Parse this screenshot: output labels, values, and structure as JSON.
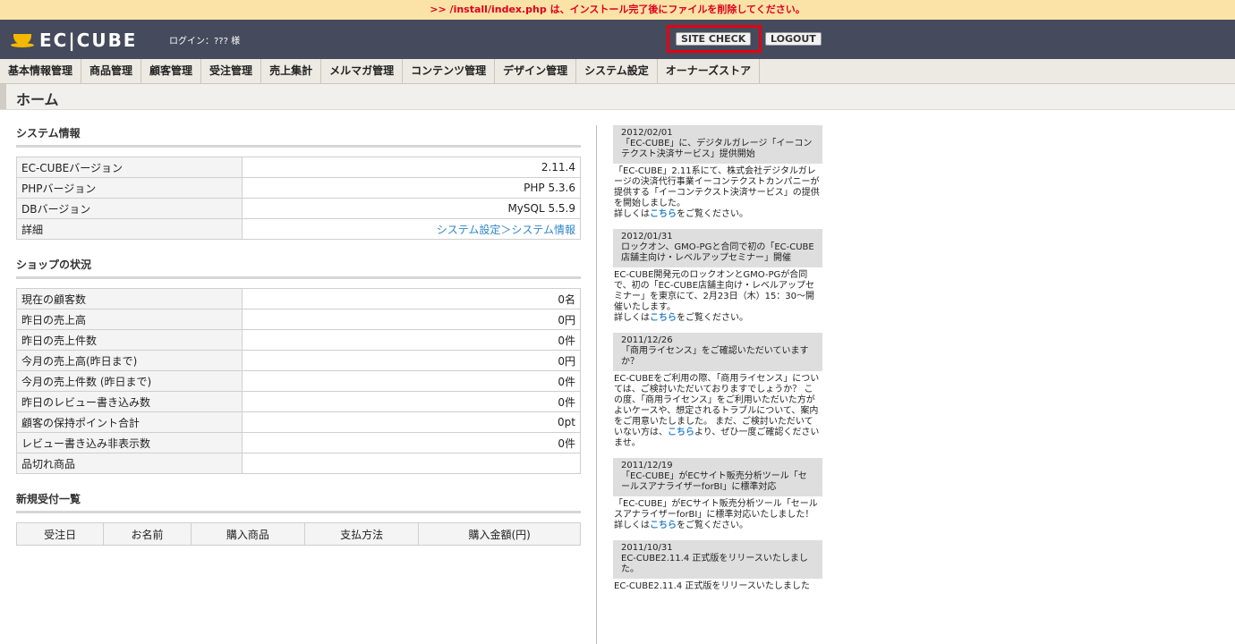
{
  "warning": ">> /install/index.php は、インストール完了後にファイルを削除してください。",
  "header": {
    "logo_text": "EC|CUBE",
    "login": "ログイン：??? 様",
    "site_check": "SITE CHECK",
    "logout": "LOGOUT"
  },
  "nav": [
    "基本情報管理",
    "商品管理",
    "顧客管理",
    "受注管理",
    "売上集計",
    "メルマガ管理",
    "コンテンツ管理",
    "デザイン管理",
    "システム設定",
    "オーナーズストア"
  ],
  "page_title": "ホーム",
  "system_info": {
    "title": "システム情報",
    "rows": [
      {
        "label": "EC-CUBEバージョン",
        "value": "2.11.4"
      },
      {
        "label": "PHPバージョン",
        "value": "PHP 5.3.6"
      },
      {
        "label": "DBバージョン",
        "value": "MySQL 5.5.9"
      }
    ],
    "detail_label": "詳細",
    "detail_link": "システム設定＞システム情報"
  },
  "shop_status": {
    "title": "ショップの状況",
    "rows": [
      {
        "label": "現在の顧客数",
        "value": "0名"
      },
      {
        "label": "昨日の売上高",
        "value": "0円"
      },
      {
        "label": "昨日の売上件数",
        "value": "0件"
      },
      {
        "label": "今月の売上高(昨日まで)",
        "value": "0円"
      },
      {
        "label": "今月の売上件数 (昨日まで)",
        "value": "0件"
      },
      {
        "label": "昨日のレビュー書き込み数",
        "value": "0件"
      },
      {
        "label": "顧客の保持ポイント合計",
        "value": "0pt"
      },
      {
        "label": "レビュー書き込み非表示数",
        "value": "0件"
      },
      {
        "label": "品切れ商品",
        "value": ""
      }
    ]
  },
  "new_orders": {
    "title": "新規受付一覧",
    "columns": [
      "受注日",
      "お名前",
      "購入商品",
      "支払方法",
      "購入金額(円)"
    ]
  },
  "news": [
    {
      "date": "2012/02/01",
      "head": "「EC-CUBE」に、デジタルガレージ「イーコンテクスト決済サービス」提供開始",
      "body": "「EC-CUBE」2.11系にて、株式会社デジタルガレージの決済代行事業イーコンテクストカンパニーが提供する「イーコンテクスト決済サービス」の提供を開始しました。",
      "pre": "詳しくは",
      "link": "こちら",
      "post": "をご覧ください。"
    },
    {
      "date": "2012/01/31",
      "head": "ロックオン、GMO-PGと合同で初の「EC-CUBE店舗主向け・レベルアップセミナー」開催",
      "body": "EC-CUBE開発元のロックオンとGMO-PGが合同で、初の「EC-CUBE店舗主向け・レベルアップセミナー」を東京にて、2月23日（木）15：30〜開催いたします。",
      "pre": "詳しくは",
      "link": "こちら",
      "post": "をご覧ください。"
    },
    {
      "date": "2011/12/26",
      "head": "「商用ライセンス」をご確認いただいていますか？",
      "body": "EC-CUBEをご利用の際、「商用ライセンス」については、ご検討いただいておりますでしょうか？ この度、「商用ライセンス」をご利用いただいた方がよいケースや、想定されるトラブルについて、案内をご用意いたしました。 まだ、ご検討いただいていない方は、",
      "pre": "",
      "link": "こちら",
      "post": "より、ぜひ一度ご確認くださいませ。"
    },
    {
      "date": "2011/12/19",
      "head": "「EC-CUBE」がECサイト販売分析ツール「セールスアナライザーforBI」に標準対応",
      "body": "「EC-CUBE」がECサイト販売分析ツール「セールスアナライザーforBI」に標準対応いたしました！",
      "pre": "詳しくは",
      "link": "こちら",
      "post": "をご覧ください。"
    },
    {
      "date": "2011/10/31",
      "head": "EC-CUBE2.11.4 正式版をリリースいたしました。",
      "body": "EC-CUBE2.11.4 正式版をリリースいたしました",
      "pre": "",
      "link": "",
      "post": ""
    }
  ]
}
